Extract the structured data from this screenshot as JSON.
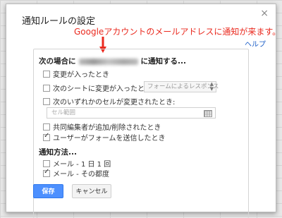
{
  "dialog": {
    "title": "通知ルールの設定",
    "close_glyph": "×",
    "help_link": "ヘルプ"
  },
  "annotation": {
    "text": "Googleアカウントのメールアドレスに通知が来ます。",
    "color": "#ea2a1f"
  },
  "trigger": {
    "heading_prefix": "次の場合に",
    "heading_suffix": "に通知する...",
    "options": [
      {
        "label": "変更が入ったとき",
        "checked": false
      },
      {
        "label": "次のシートに変更が入ったとき:",
        "checked": false
      },
      {
        "label": "次のいずれかのセルが変更されたとき:",
        "checked": false
      },
      {
        "label": "共同編集者が追加/削除されたとき",
        "checked": false
      },
      {
        "label": "ユーザーがフォームを送信したとき",
        "checked": true
      }
    ],
    "sheet_select_value": "フォームによるレスポンス",
    "cell_range_placeholder": "セル範囲"
  },
  "method": {
    "heading": "通知方法...",
    "options": [
      {
        "label": "メール - 1 日 1 回",
        "checked": false
      },
      {
        "label": "メール - その都度",
        "checked": true
      }
    ]
  },
  "buttons": {
    "save": "保存",
    "cancel": "キャンセル"
  },
  "colors": {
    "primary_button": "#4d90fe",
    "link": "#1a5dc7"
  }
}
